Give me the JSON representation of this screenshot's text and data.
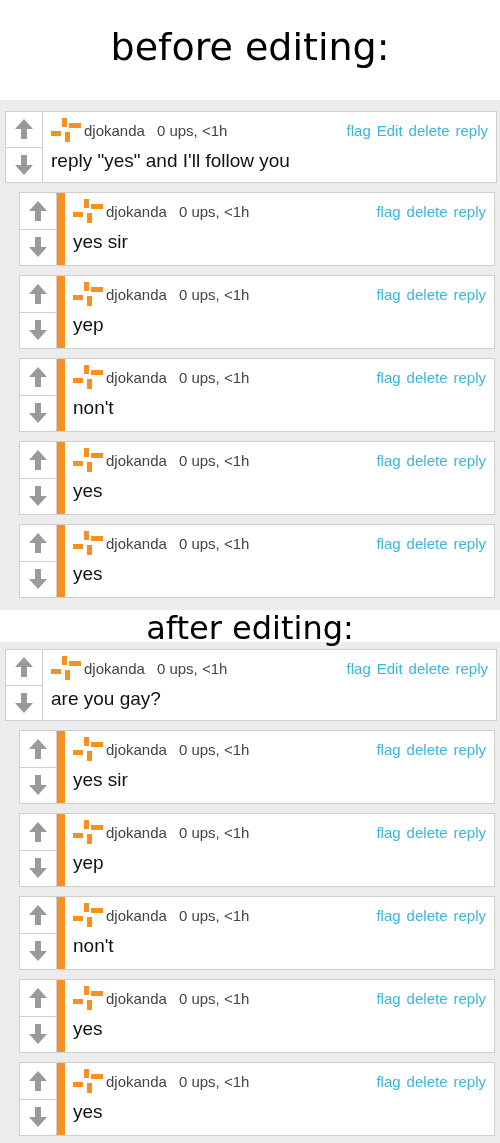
{
  "sections": [
    {
      "caption": "before editing:",
      "comments": [
        {
          "kind": "parent",
          "username": "djokanda",
          "meta": "0 ups, <1h",
          "actions": [
            "flag",
            "Edit",
            "delete",
            "reply"
          ],
          "text": "reply \"yes\" and I'll follow you"
        },
        {
          "kind": "reply",
          "username": "djokanda",
          "meta": "0 ups, <1h",
          "actions": [
            "flag",
            "delete",
            "reply"
          ],
          "text": "yes sir"
        },
        {
          "kind": "reply",
          "username": "djokanda",
          "meta": "0 ups, <1h",
          "actions": [
            "flag",
            "delete",
            "reply"
          ],
          "text": "yep"
        },
        {
          "kind": "reply",
          "username": "djokanda",
          "meta": "0 ups, <1h",
          "actions": [
            "flag",
            "delete",
            "reply"
          ],
          "text": "non't"
        },
        {
          "kind": "reply",
          "username": "djokanda",
          "meta": "0 ups, <1h",
          "actions": [
            "flag",
            "delete",
            "reply"
          ],
          "text": "yes"
        },
        {
          "kind": "reply",
          "username": "djokanda",
          "meta": "0 ups, <1h",
          "actions": [
            "flag",
            "delete",
            "reply"
          ],
          "text": "yes"
        }
      ]
    },
    {
      "caption": "after editing:",
      "comments": [
        {
          "kind": "parent",
          "username": "djokanda",
          "meta": "0 ups, <1h",
          "actions": [
            "flag",
            "Edit",
            "delete",
            "reply"
          ],
          "text": "are you gay?"
        },
        {
          "kind": "reply",
          "username": "djokanda",
          "meta": "0 ups, <1h",
          "actions": [
            "flag",
            "delete",
            "reply"
          ],
          "text": "yes sir"
        },
        {
          "kind": "reply",
          "username": "djokanda",
          "meta": "0 ups, <1h",
          "actions": [
            "flag",
            "delete",
            "reply"
          ],
          "text": "yep"
        },
        {
          "kind": "reply",
          "username": "djokanda",
          "meta": "0 ups, <1h",
          "actions": [
            "flag",
            "delete",
            "reply"
          ],
          "text": "non't"
        },
        {
          "kind": "reply",
          "username": "djokanda",
          "meta": "0 ups, <1h",
          "actions": [
            "flag",
            "delete",
            "reply"
          ],
          "text": "yes"
        },
        {
          "kind": "reply",
          "username": "djokanda",
          "meta": "0 ups, <1h",
          "actions": [
            "flag",
            "delete",
            "reply"
          ],
          "text": "yes"
        }
      ]
    }
  ]
}
